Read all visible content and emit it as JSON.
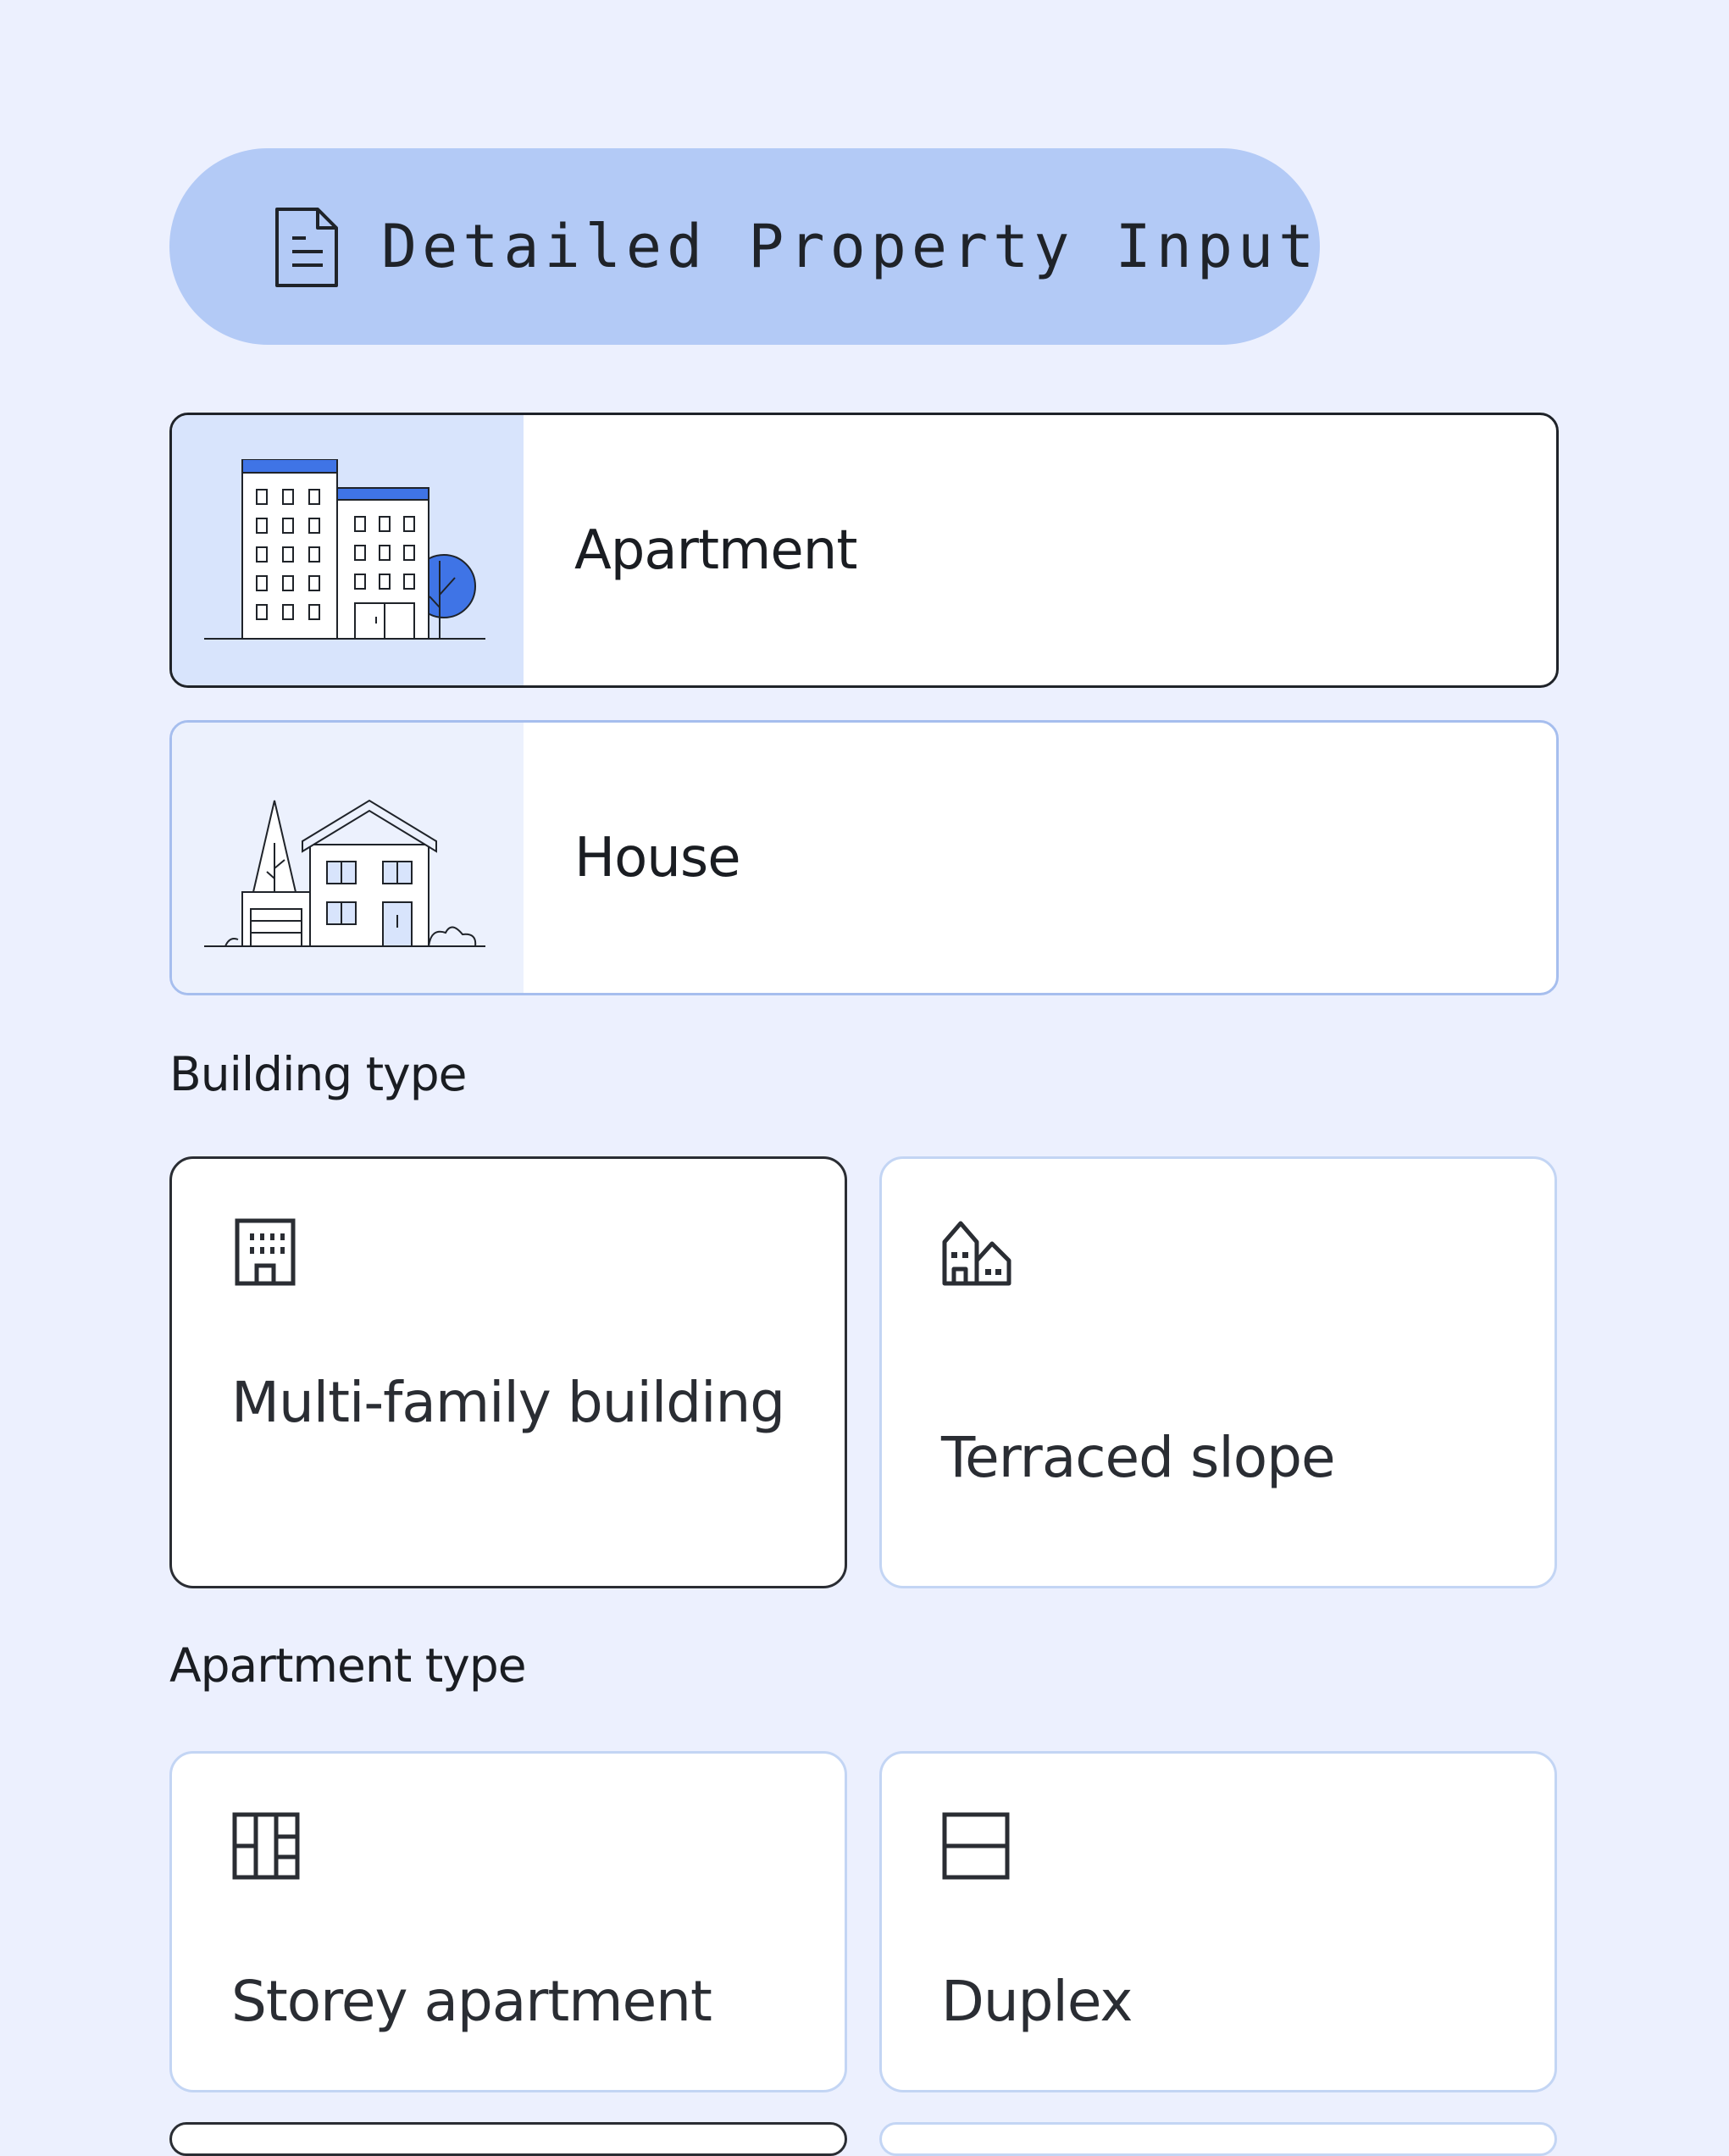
{
  "header": {
    "title": "Detailed Property Input",
    "icon": "document-icon"
  },
  "property_types": [
    {
      "label": "Apartment",
      "icon": "apartment-building-illustration",
      "selected": true
    },
    {
      "label": "House",
      "icon": "house-illustration",
      "selected": false
    }
  ],
  "building_type": {
    "label": "Building type",
    "options": [
      {
        "label": "Multi-family building",
        "icon": "multi-family-building-icon",
        "selected": true
      },
      {
        "label": "Terraced slope",
        "icon": "terraced-houses-icon",
        "selected": false
      }
    ]
  },
  "apartment_type": {
    "label": "Apartment type",
    "options": [
      {
        "label": "Storey apartment",
        "icon": "floor-plan-icon",
        "selected": false
      },
      {
        "label": "Duplex",
        "icon": "duplex-icon",
        "selected": false
      }
    ]
  },
  "colors": {
    "background": "#ECF0FE",
    "pill": "#B3CAF6",
    "accent_blue": "#3F74E6",
    "selected_border": "#1F2329",
    "unselected_border": "#A6BEEE"
  }
}
